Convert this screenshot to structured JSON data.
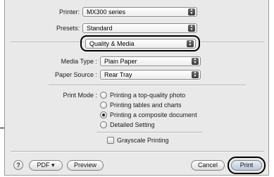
{
  "printer": {
    "label": "Printer:",
    "value": "MX300 series"
  },
  "presets": {
    "label": "Presets:",
    "value": "Standard"
  },
  "panel": {
    "value": "Quality & Media"
  },
  "media_type": {
    "label": "Media Type :",
    "value": "Plain Paper"
  },
  "paper_source": {
    "label": "Paper Source :",
    "value": "Rear Tray"
  },
  "print_mode": {
    "label": "Print Mode :",
    "options": [
      {
        "label": "Printing a top-quality photo",
        "selected": false
      },
      {
        "label": "Printing tables and charts",
        "selected": false
      },
      {
        "label": "Printing a composite document",
        "selected": true
      },
      {
        "label": "Detailed Setting",
        "selected": false
      }
    ]
  },
  "grayscale": {
    "label": "Grayscale Printing",
    "checked": false
  },
  "buttons": {
    "help": "?",
    "pdf": "PDF ▾",
    "preview": "Preview",
    "cancel": "Cancel",
    "print": "Print"
  },
  "icons": {
    "popup_arrows": "up-down-arrows-icon",
    "help": "question-mark-icon"
  }
}
